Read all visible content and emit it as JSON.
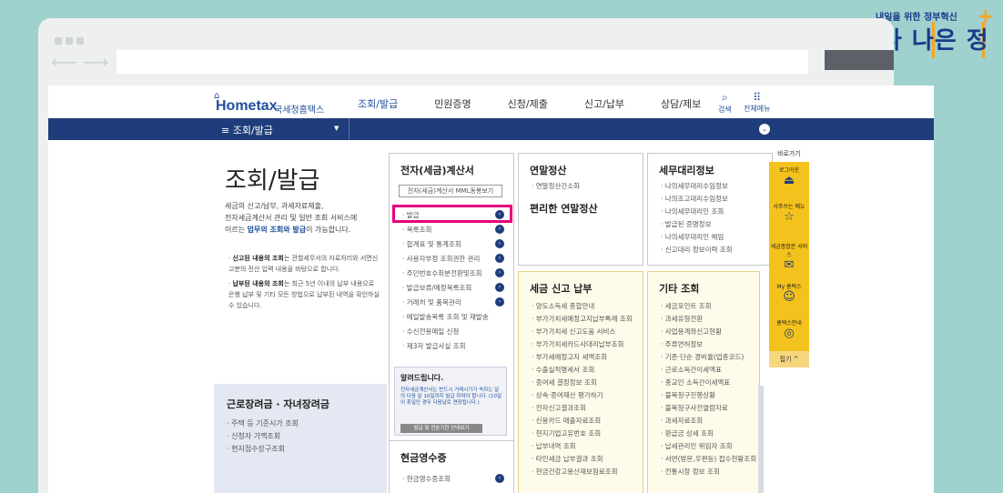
{
  "gov_badge": {
    "small": "내일을 위한 정부혁신",
    "big": "보다 나은 정부"
  },
  "logo": {
    "name": "Hometax",
    "sub": "국세청홈택스"
  },
  "topnav": [
    "조회/발급",
    "민원증명",
    "신청/제출",
    "신고/납부",
    "상담/제보"
  ],
  "hdr_icons": {
    "search": "검색",
    "allmenu": "전체메뉴"
  },
  "bluebar": {
    "menu": "≡  조회/발급"
  },
  "page_title": "조회/발급",
  "intro": {
    "p1": "세금의 신고/납부, 과세자료제출,",
    "p2": "전자세금계산서 관리 및 일반 조회 서비스에",
    "p3_pre": "이르는 ",
    "p3_hl": "업무의 조회와 발급",
    "p3_post": "이 가능합니다."
  },
  "bullets": [
    {
      "bold": "신고된 내용의 조회",
      "text": "는 관할세무서의 자료처리와 서면신고분의 전산 입력 내용을 바탕으로 합니다."
    },
    {
      "bold": "납부된 내용의 조회",
      "text": "는 최근 5년 이내의 납부 내용으로 은행 납부 및 기타 모든 방법으로 납부된 내역을 확인하실 수 있습니다."
    }
  ],
  "left_box": {
    "title": "근로장려금 · 자녀장려금",
    "items": [
      "주택 등 기준시가 조회",
      "신청자 가맥조회",
      "현지접수장구조회"
    ]
  },
  "col1": {
    "title": "전자(세금)계산서",
    "btn": "전자(세금)계산서 MML동봉보기",
    "links": [
      "발급",
      "목록조회",
      "합계표 및 통계조회",
      "사용자부정 조회권한 관리",
      "주민번호수취분전환및조회",
      "발급보류/예정목록조회",
      "거래처 및 품목관리",
      "메일발송목록 조회 및 재발송",
      "수신전용메일 신청",
      "제3자 발급사실 조회"
    ],
    "notice_title": "알려드립니다.",
    "notice_text": "전자세금계산서는 반드시 거래시기가 속하는 달의 다음 달 10일까지 발급 하여야 합니다. (10일이 휴일인 경우 다음날로 연장됩니다.)",
    "notice_btn": "발급 및 전송기한 안내보기",
    "cash_title": "현금영수증",
    "cash_links": [
      "현금영수증조회"
    ]
  },
  "col2": {
    "title": "연말정산",
    "link": "연말정산간소화",
    "sub": "편리한 연말정산"
  },
  "col2b": {
    "title": "세금 신고 납부",
    "links": [
      "양도소득세 종합안내",
      "부가가치세예정고지납부특례 조회",
      "부가가치세 신고도움 서비스",
      "부가가치세카드사대리납부조회",
      "부가세예정고지 세액조회",
      "수출실적명세서 조회",
      "증여세 결정정보 조회",
      "상속·증여재산 평가하기",
      "전자신고결과조회",
      "신용카드 매출자료조회",
      "현지기업고유번호 조회",
      "납부내역 조회",
      "타인세금 납부결과 조회",
      "현금건강고용산재보험료조회"
    ]
  },
  "col3": {
    "title": "세무대리정보",
    "links": [
      "나의세무대리수임정보",
      "나의조고대리수임정보",
      "나의세무대리인 조회",
      "발급된 증명정보",
      "나의세무대리인 해임",
      "신고대리 정보이력 조회"
    ]
  },
  "col3b": {
    "title": "기타 조회",
    "links": [
      "세금포인트 조회",
      "과세유형전환",
      "사업용계좌신고현황",
      "주류면허정보",
      "기준·단순 경비율(업종코드)",
      "근로소득간이세액표",
      "종교인 소득간이세액표",
      "불복청구진행상황",
      "불복청구사전열람자료",
      "과세자료조회",
      "환급금 상세 조회",
      "납세관리인 위임자 조회",
      "서면(방문,우편등) 접수현황조회",
      "전통시장 정보 조회"
    ]
  },
  "rightbar": {
    "head": "바로가기",
    "items": [
      {
        "label": "로그아웃",
        "icon": "logout-icon"
      },
      {
        "label": "사주쓰는 메뉴",
        "icon": "star-icon"
      },
      {
        "label": "세금종합분 서비스",
        "icon": "mail-icon"
      },
      {
        "label": "My 홈택스",
        "icon": "person-icon"
      },
      {
        "label": "홈택스안내",
        "icon": "guide-icon"
      }
    ],
    "close": "접기 ^"
  }
}
